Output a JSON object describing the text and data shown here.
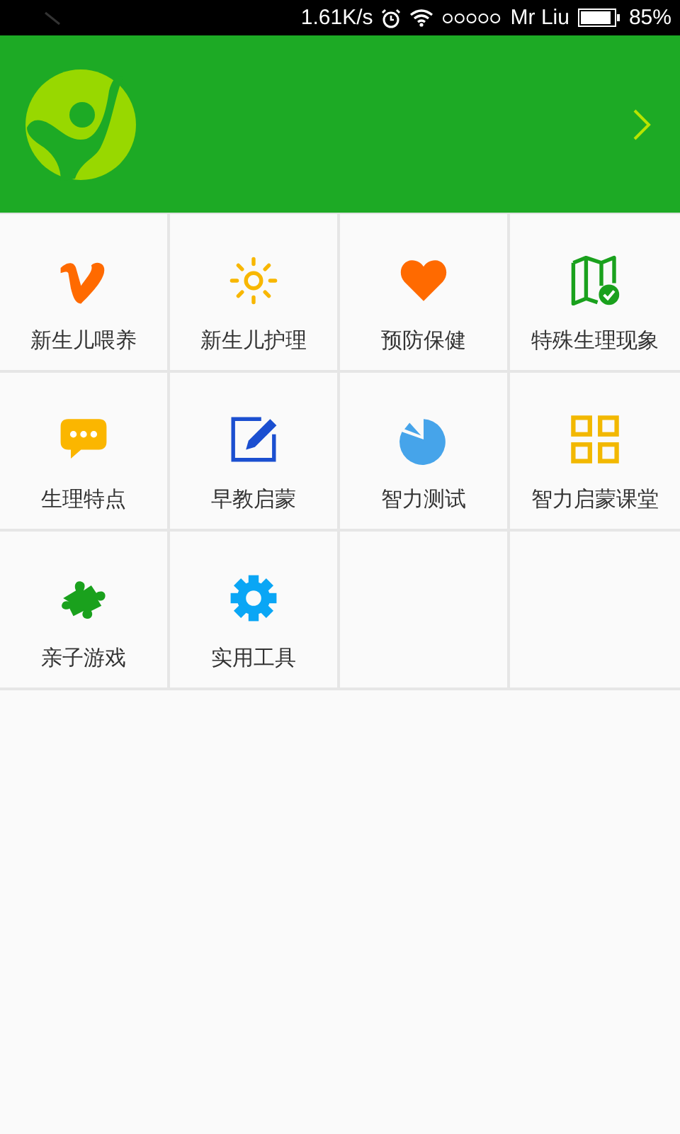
{
  "status_bar": {
    "speed": "1.61K/s",
    "carrier": "Mr Liu",
    "battery": "85%"
  },
  "grid": [
    {
      "label": "新生儿喂养"
    },
    {
      "label": "新生儿护理"
    },
    {
      "label": "预防保健"
    },
    {
      "label": "特殊生理现象"
    },
    {
      "label": "生理特点"
    },
    {
      "label": "早教启蒙"
    },
    {
      "label": "智力测试"
    },
    {
      "label": "智力启蒙课堂"
    },
    {
      "label": "亲子游戏"
    },
    {
      "label": "实用工具"
    }
  ]
}
